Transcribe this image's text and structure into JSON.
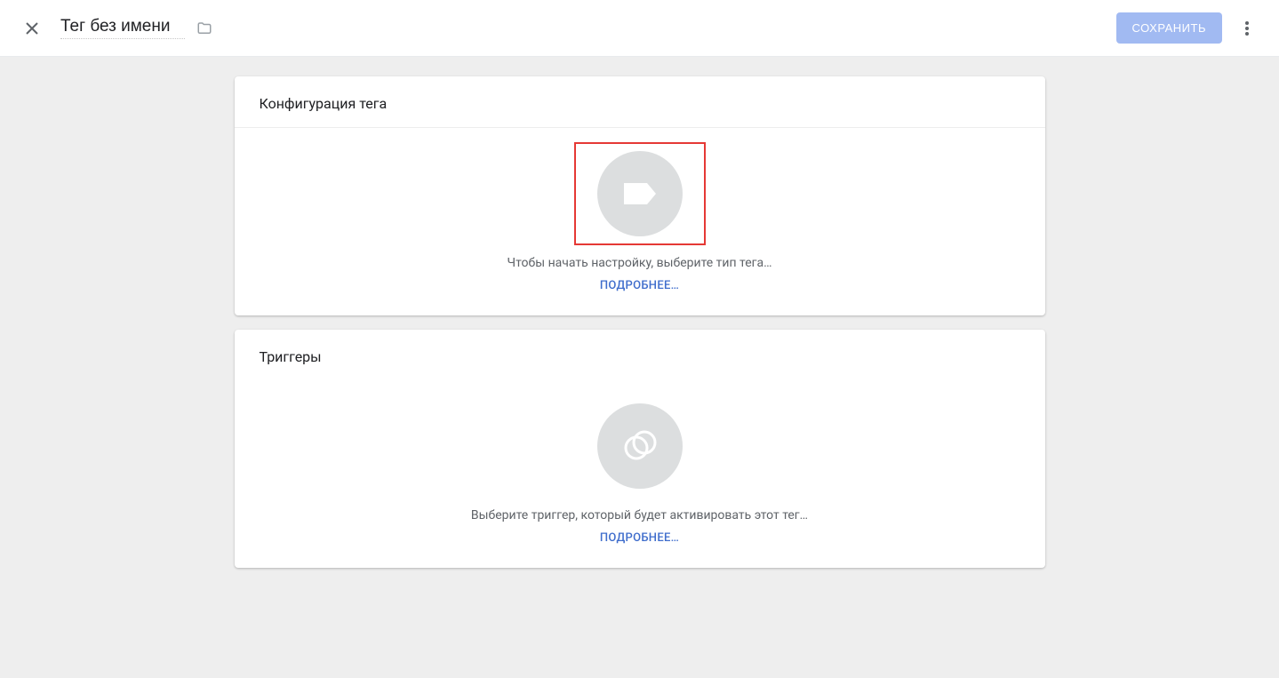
{
  "header": {
    "title": "Тег без имени",
    "save_label": "СОХРАНИТЬ"
  },
  "cards": {
    "config": {
      "title": "Конфигурация тега",
      "helper": "Чтобы начать настройку, выберите тип тега…",
      "more": "ПОДРОБНЕЕ…"
    },
    "triggers": {
      "title": "Триггеры",
      "helper": "Выберите триггер, который будет активировать этот тег…",
      "more": "ПОДРОБНЕЕ…"
    }
  }
}
